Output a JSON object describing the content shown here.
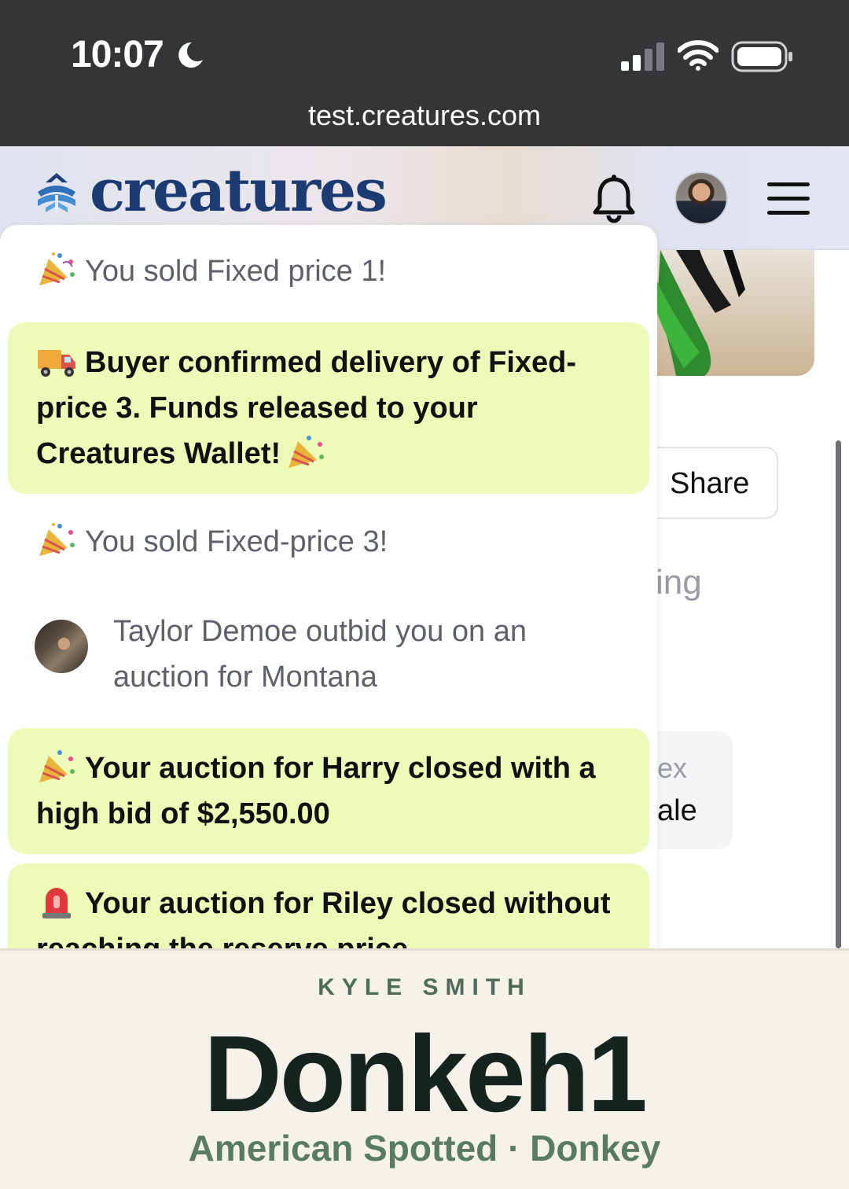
{
  "status_bar": {
    "time": "10:07"
  },
  "browser": {
    "url": "test.creatures.com"
  },
  "header": {
    "logo_text": "creatures",
    "brand_color": "#1d3b73"
  },
  "background": {
    "share_label": "Share",
    "partial_text_1": "ing",
    "partial_text_2": "ex",
    "partial_text_3": "ale"
  },
  "notifications": [
    {
      "text": "You sold Fixed price 1!",
      "icon": "party-popper-icon",
      "highlighted": false
    },
    {
      "text": "Buyer confirmed delivery of Fixed-price 3. Funds released to your Creatures Wallet!",
      "icon": "delivery-truck-icon",
      "highlighted": true
    },
    {
      "text": "You sold Fixed-price 3!",
      "icon": "party-popper-icon",
      "highlighted": false
    },
    {
      "text": "Taylor Demoe outbid you on an auction for Montana",
      "icon": "avatar",
      "highlighted": false
    },
    {
      "text": "Your auction for Harry closed with a high bid of $2,550.00",
      "icon": "party-popper-icon",
      "highlighted": true
    },
    {
      "text": "Your auction for Riley closed without reaching the reserve price",
      "icon": "siren-icon",
      "highlighted": true
    }
  ],
  "creature": {
    "owner": "KYLE SMITH",
    "name": "Donkeh1",
    "breed": "American Spotted · Donkey"
  },
  "colors": {
    "highlight_bg": "#eefbb8",
    "status_bar_bg": "#343537"
  }
}
